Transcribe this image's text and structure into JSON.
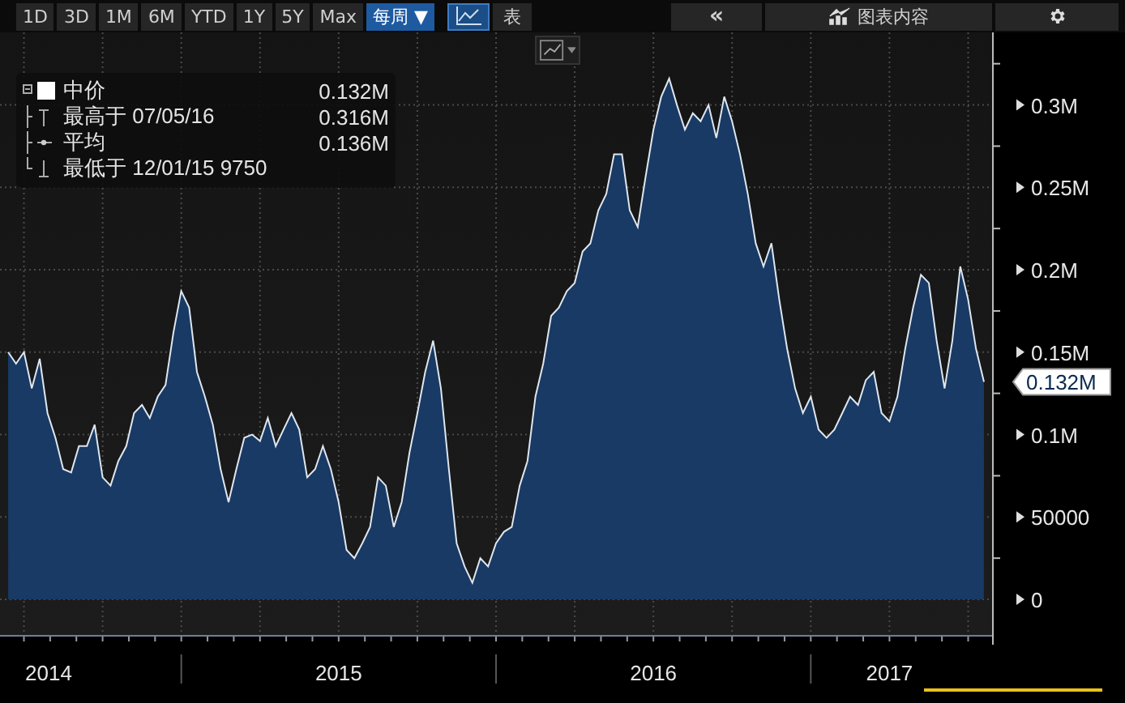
{
  "toolbar": {
    "ranges": [
      "1D",
      "3D",
      "1M",
      "6M",
      "YTD",
      "1Y",
      "5Y",
      "Max"
    ],
    "frequency": "每周 ▼",
    "views": [
      {
        "kind": "chart",
        "selected": true
      },
      {
        "kind": "table",
        "label": "表",
        "selected": false
      }
    ],
    "collapse": "«",
    "chart_content": "图表内容"
  },
  "legend": {
    "items": [
      {
        "kind": "series",
        "label": "中价",
        "value": "0.132M"
      },
      {
        "kind": "high",
        "label": "最高于 07/05/16",
        "value": "0.316M"
      },
      {
        "kind": "average",
        "label": "平均",
        "value": "0.136M"
      },
      {
        "kind": "low",
        "label": "最低于 12/01/15 9750"
      }
    ]
  },
  "last_value_tag": "0.132M",
  "chart_data": {
    "type": "area",
    "grid": true,
    "xlim": [
      2014.424,
      2017.576
    ],
    "xticks": [
      {
        "value": 2014.5,
        "label": "2014"
      },
      {
        "value": 2015.5,
        "label": "2015"
      },
      {
        "value": 2016.5,
        "label": "2016"
      },
      {
        "value": 2017.25,
        "label": "2017"
      }
    ],
    "ylim": [
      -21600,
      344000
    ],
    "yticks": [
      {
        "value": 0,
        "label": "0"
      },
      {
        "value": 50000,
        "label": "50000"
      },
      {
        "value": 100000,
        "label": "0.1M"
      },
      {
        "value": 150000,
        "label": "0.15M"
      },
      {
        "value": 200000,
        "label": "0.2M"
      },
      {
        "value": 250000,
        "label": "0.25M"
      },
      {
        "value": 300000,
        "label": "0.3M"
      }
    ],
    "x": [
      2014.45,
      2014.475,
      2014.5,
      2014.525,
      2014.55,
      2014.575,
      2014.6,
      2014.625,
      2014.65,
      2014.675,
      2014.7,
      2014.725,
      2014.75,
      2014.775,
      2014.8,
      2014.825,
      2014.85,
      2014.875,
      2014.9,
      2014.925,
      2014.95,
      2014.975,
      2015,
      2015.025,
      2015.05,
      2015.075,
      2015.1,
      2015.125,
      2015.15,
      2015.175,
      2015.2,
      2015.225,
      2015.25,
      2015.275,
      2015.3,
      2015.325,
      2015.35,
      2015.375,
      2015.4,
      2015.425,
      2015.45,
      2015.475,
      2015.5,
      2015.525,
      2015.55,
      2015.575,
      2015.6,
      2015.625,
      2015.65,
      2015.675,
      2015.7,
      2015.725,
      2015.75,
      2015.775,
      2015.8,
      2015.825,
      2015.85,
      2015.875,
      2015.9,
      2015.925,
      2015.95,
      2015.975,
      2016,
      2016.025,
      2016.05,
      2016.075,
      2016.1,
      2016.125,
      2016.15,
      2016.175,
      2016.2,
      2016.225,
      2016.25,
      2016.275,
      2016.3,
      2016.325,
      2016.35,
      2016.375,
      2016.4,
      2016.425,
      2016.45,
      2016.475,
      2016.5,
      2016.525,
      2016.55,
      2016.575,
      2016.6,
      2016.625,
      2016.65,
      2016.675,
      2016.7,
      2016.725,
      2016.75,
      2016.775,
      2016.8,
      2016.825,
      2016.85,
      2016.875,
      2016.9,
      2016.925,
      2016.95,
      2016.975,
      2017,
      2017.025,
      2017.05,
      2017.075,
      2017.1,
      2017.125,
      2017.15,
      2017.175,
      2017.2,
      2017.225,
      2017.25,
      2017.275,
      2017.3,
      2017.325,
      2017.35,
      2017.375,
      2017.4,
      2017.425,
      2017.45,
      2017.475,
      2017.5,
      2017.525,
      2017.55
    ],
    "series": [
      {
        "color": "#dfe6ee",
        "values": [
          150000,
          143000,
          150000,
          128000,
          146000,
          113000,
          98000,
          79000,
          77000,
          93000,
          93000,
          106000,
          74000,
          69000,
          84000,
          93000,
          113000,
          118000,
          110000,
          123000,
          130000,
          162000,
          187000,
          177000,
          138000,
          123000,
          106000,
          79000,
          59000,
          79000,
          98000,
          100000,
          96000,
          110000,
          93000,
          103000,
          113000,
          103000,
          74000,
          79000,
          93000,
          79000,
          59000,
          30000,
          25000,
          34000,
          44000,
          74000,
          69000,
          44000,
          59000,
          89000,
          113000,
          138000,
          157000,
          128000,
          79000,
          34000,
          20000,
          10000,
          25000,
          20000,
          34000,
          41000,
          44000,
          69000,
          84000,
          123000,
          143000,
          172000,
          177000,
          187000,
          192000,
          211000,
          216000,
          236000,
          246000,
          270000,
          270000,
          236000,
          226000,
          256000,
          285000,
          305000,
          316000,
          300000,
          285000,
          295000,
          290000,
          300000,
          280000,
          305000,
          290000,
          270000,
          246000,
          216000,
          202000,
          216000,
          182000,
          152000,
          128000,
          113000,
          123000,
          103000,
          98000,
          103000,
          113000,
          123000,
          118000,
          133000,
          138000,
          113000,
          108000,
          123000,
          152000,
          177000,
          197000,
          192000,
          157000,
          128000,
          157000,
          202000,
          182000,
          152000,
          132000
        ]
      }
    ]
  }
}
